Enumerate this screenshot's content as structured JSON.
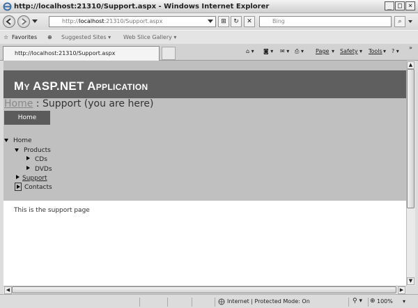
{
  "window": {
    "title": "http://localhost:21310/Support.aspx - Windows Internet Explorer"
  },
  "address": {
    "url_prefix": "http://",
    "url_host": "localhost",
    "url_rest": ":21310/Support.aspx"
  },
  "search": {
    "placeholder": "Bing"
  },
  "favorites": {
    "label": "Favorites",
    "items": [
      {
        "label": "Suggested Sites ▾"
      },
      {
        "label": "Web Slice Gallery ▾"
      }
    ]
  },
  "tab": {
    "title": "http://localhost:21310/Support.aspx"
  },
  "commands": {
    "page": "Page",
    "safety": "Safety",
    "tools": "Tools"
  },
  "page": {
    "app_title": "My ASP.NET Application",
    "breadcrumb": {
      "home": "Home",
      "separator": " : ",
      "current": "Support (you are here)"
    },
    "menu_button": "Home",
    "tree": {
      "home": "Home",
      "products": "Products",
      "cds": "CDs",
      "dvds": "DVDs",
      "support": "Support",
      "contacts": "Contacts"
    },
    "content": "This is the support page"
  },
  "status": {
    "zone": "Internet | Protected Mode: On",
    "zoom": "100%"
  }
}
